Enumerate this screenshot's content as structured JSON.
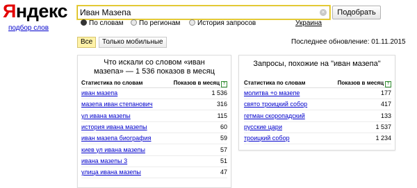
{
  "logo": {
    "first_letter": "Я",
    "rest": "ндекс"
  },
  "wordstat_link": "подбор слов",
  "search": {
    "value": "Иван Мазепа",
    "clear_icon": "×",
    "button_label": "Подобрать"
  },
  "radios": [
    {
      "label": "По словам",
      "checked": true
    },
    {
      "label": "По регионам",
      "checked": false
    },
    {
      "label": "История запросов",
      "checked": false
    }
  ],
  "region": "Украина",
  "tabs": [
    {
      "label": "Все",
      "active": true
    },
    {
      "label": "Только мобильные",
      "active": false
    }
  ],
  "updated": "Последнее обновление: 01.11.2015",
  "left_panel": {
    "title_line1": "Что искали со словом «иван",
    "title_line2": "мазепа» — 1 536 показов в месяц",
    "col_query": "Статистика по словам",
    "col_count": "Показов в месяц",
    "rows": [
      {
        "query": "иван мазепа",
        "count": "1 536"
      },
      {
        "query": "мазепа иван степанович",
        "count": "316"
      },
      {
        "query": "ул ивана мазепы",
        "count": "115"
      },
      {
        "query": "история ивана мазепы",
        "count": "60"
      },
      {
        "query": "иван мазепа биография",
        "count": "59"
      },
      {
        "query": "киев ул ивана мазепы",
        "count": "57"
      },
      {
        "query": "ивана мазепы 3",
        "count": "51"
      },
      {
        "query": "улица ивана мазепы",
        "count": "47"
      }
    ]
  },
  "right_panel": {
    "title": "Запросы, похожие на \"иван мазепа\"",
    "col_query": "Статистика по словам",
    "col_count": "Показов в месяц",
    "rows": [
      {
        "query": "молитва +о мазепе",
        "count": "177"
      },
      {
        "query": "свято троицкий собор",
        "count": "417"
      },
      {
        "query": "гетман скоропадский",
        "count": "133"
      },
      {
        "query": "русские цари",
        "count": "1 537"
      },
      {
        "query": "троицкий собор",
        "count": "1 234"
      }
    ]
  },
  "help_icon": "?"
}
